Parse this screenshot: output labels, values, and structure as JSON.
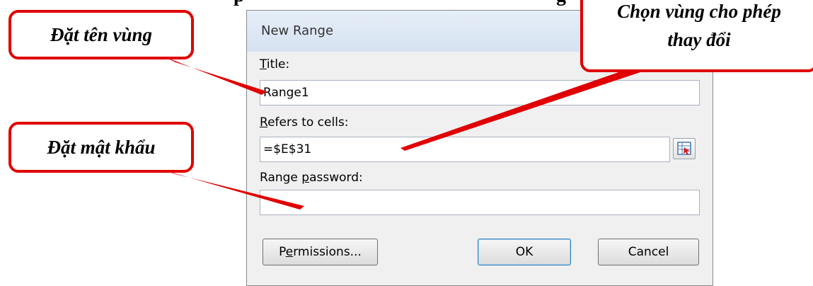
{
  "page": {
    "top_text_left": "p",
    "top_text_right": "g"
  },
  "dialog": {
    "title": "New Range",
    "title_label": "Title:",
    "title_value": "Range1",
    "refers_label": "Refers to cells:",
    "refers_value": "=$E$31",
    "password_label": "Range password:",
    "password_value": "",
    "permissions_button": "Permissions...",
    "ok_button": "OK",
    "cancel_button": "Cancel",
    "collapse_icon": "range-collapse-icon"
  },
  "callouts": {
    "name_range": "Đặt tên vùng",
    "set_password": "Đặt mật khẩu",
    "choose_area_line1": "Chọn vùng cho phép",
    "choose_area_line2": "thay đổi"
  },
  "colors": {
    "callout_border": "#e00000",
    "pointer_line": "#e00000",
    "dialog_bg": "#f0f0f0"
  }
}
